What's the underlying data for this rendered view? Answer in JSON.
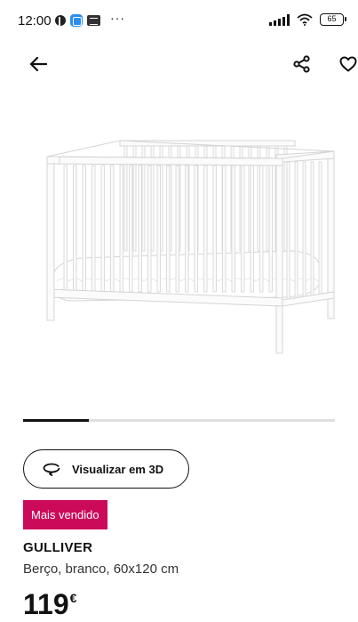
{
  "status_bar": {
    "time": "12:00",
    "battery": "65"
  },
  "icons": {
    "back": "arrow-left-icon",
    "share": "share-icon",
    "favorite": "heart-icon",
    "view3d": "rotate-3d-icon"
  },
  "product": {
    "image_alt": "crib-image",
    "view3d_label": "Visualizar em 3D",
    "badge": "Mais vendido",
    "name": "GULLIVER",
    "description": "Berço, branco, 60x120 cm",
    "price": "119",
    "currency": "€"
  },
  "carousel": {
    "progress": 0.21
  },
  "colors": {
    "badge_bg": "#cc0a5a",
    "text": "#111111"
  }
}
